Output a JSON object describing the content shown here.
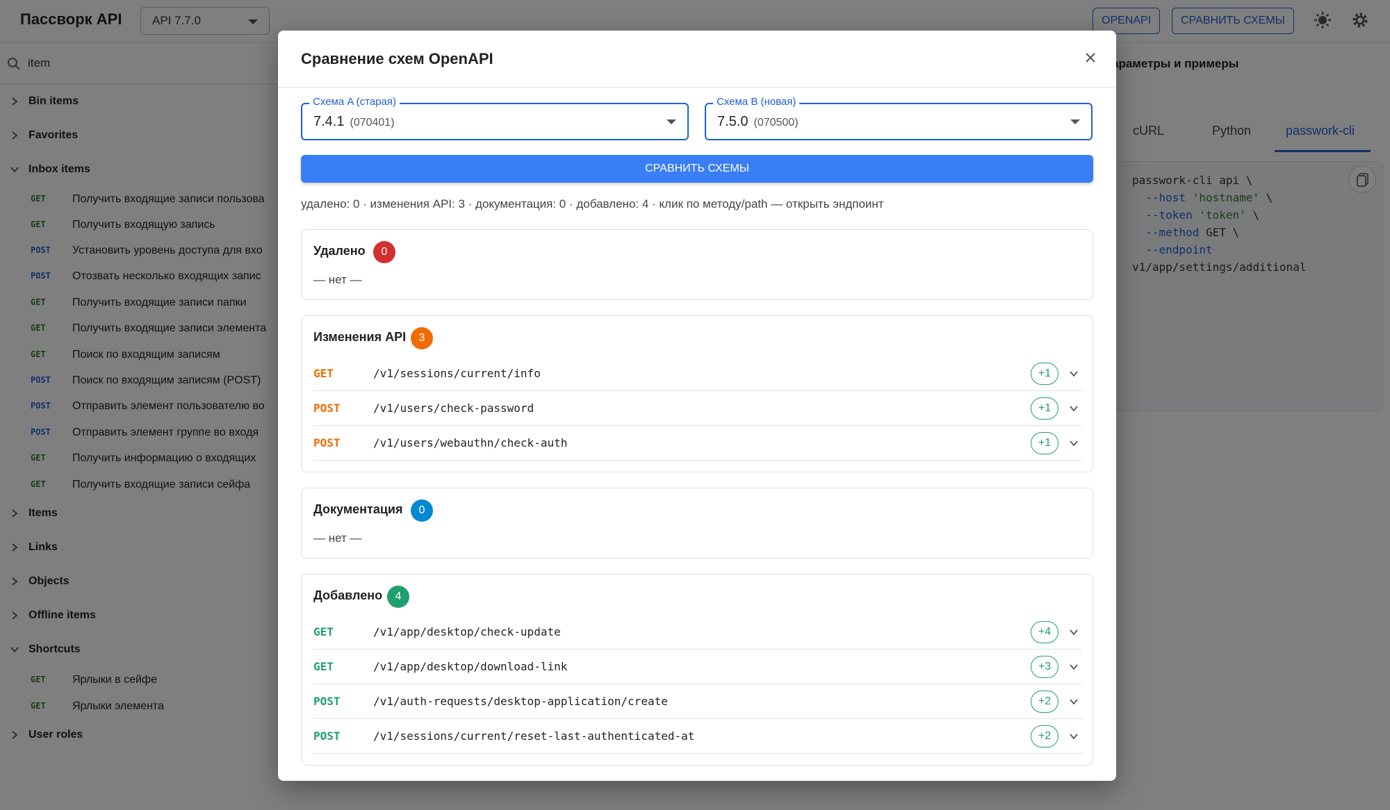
{
  "app": {
    "title": "Пассворк API",
    "version": "API 7.7.0",
    "openapi_label": "OPENAPI",
    "compare_label": "СРАВНИТЬ СХЕМЫ"
  },
  "sidebar": {
    "search_value": "item",
    "groups": [
      {
        "label": "Bin items"
      },
      {
        "label": "Favorites"
      },
      {
        "label": "Inbox items"
      },
      {
        "label": "Items"
      },
      {
        "label": "Links"
      },
      {
        "label": "Objects"
      },
      {
        "label": "Offline items"
      },
      {
        "label": "Shortcuts"
      },
      {
        "label": "User roles"
      }
    ],
    "inbox_endpoints": [
      {
        "method": "GET",
        "label": "Получить входящие записи пользова"
      },
      {
        "method": "GET",
        "label": "Получить входящую запись"
      },
      {
        "method": "POST",
        "label": "Установить уровень доступа для вхо"
      },
      {
        "method": "POST",
        "label": "Отозвать несколько входящих запис"
      },
      {
        "method": "GET",
        "label": "Получить входящие записи папки"
      },
      {
        "method": "GET",
        "label": "Получить входящие записи элемента"
      },
      {
        "method": "GET",
        "label": "Поиск по входящим записям"
      },
      {
        "method": "POST",
        "label": "Поиск по входящим записям (POST)"
      },
      {
        "method": "POST",
        "label": "Отправить элемент пользователю во"
      },
      {
        "method": "POST",
        "label": "Отправить элемент группе во входя"
      },
      {
        "method": "GET",
        "label": "Получить информацию о входящих"
      },
      {
        "method": "GET",
        "label": "Получить входящие записи сейфа"
      }
    ],
    "shortcut_endpoints": [
      {
        "method": "GET",
        "label": "Ярлыки в сейфе"
      },
      {
        "method": "GET",
        "label": "Ярлыки элемента"
      }
    ]
  },
  "right_panel": {
    "title": "араметры и примеры",
    "tabs": [
      "cURL",
      "Python",
      "passwork-cli"
    ],
    "code": {
      "line1": "passwork-cli api \\",
      "host_flag": "--host",
      "host_val": "'hostname'",
      "token_flag": "--token",
      "token_val": "'token'",
      "method_flag": "--method",
      "method_val": "GET \\",
      "endpoint_flag": "--endpoint",
      "endpoint_val": "v1/app/settings/additional"
    }
  },
  "modal": {
    "title": "Сравнение схем OpenAPI",
    "schema_a": {
      "legend": "Схема A (старая)",
      "value": "7.4.1",
      "code": "(070401)"
    },
    "schema_b": {
      "legend": "Схема B (новая)",
      "value": "7.5.0",
      "code": "(070500)"
    },
    "compare_button": "СРАВНИТЬ СХЕМЫ",
    "summary": "удалено: 0 · изменения API: 3 · документация: 0 · добавлено: 4 · клик по методу/path — открыть эндпоинт",
    "sections": {
      "removed": {
        "title": "Удалено",
        "count": "0",
        "empty": "— нет —",
        "color": "#d32f2f"
      },
      "changed": {
        "title": "Изменения API",
        "count": "3",
        "color": "#ef6c00",
        "rows": [
          {
            "method": "GET",
            "path": "/v1/sessions/current/info",
            "delta": "+1"
          },
          {
            "method": "POST",
            "path": "/v1/users/check-password",
            "delta": "+1"
          },
          {
            "method": "POST",
            "path": "/v1/users/webauthn/check-auth",
            "delta": "+1"
          }
        ]
      },
      "docs": {
        "title": "Документация",
        "count": "0",
        "empty": "— нет —",
        "color": "#0288d1"
      },
      "added": {
        "title": "Добавлено",
        "count": "4",
        "color": "#1f9e6e",
        "rows": [
          {
            "method": "GET",
            "path": "/v1/app/desktop/check-update",
            "delta": "+4"
          },
          {
            "method": "GET",
            "path": "/v1/app/desktop/download-link",
            "delta": "+3"
          },
          {
            "method": "POST",
            "path": "/v1/auth-requests/desktop-application/create",
            "delta": "+2"
          },
          {
            "method": "POST",
            "path": "/v1/sessions/current/reset-last-authenticated-at",
            "delta": "+2"
          }
        ]
      }
    }
  }
}
